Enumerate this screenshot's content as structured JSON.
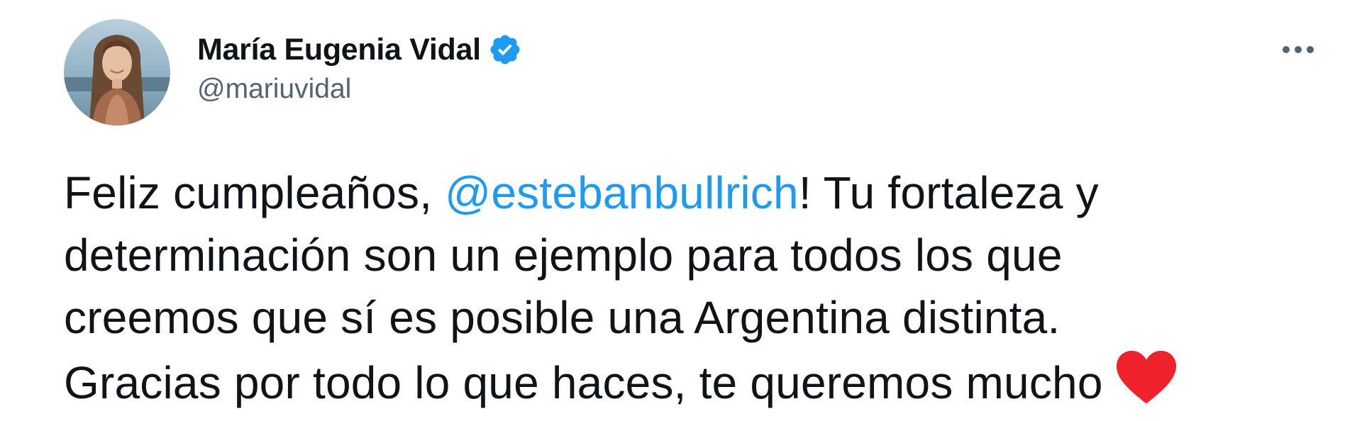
{
  "tweet": {
    "author": {
      "display_name": "María Eugenia Vidal",
      "handle": "@mariuvidal",
      "verified": true
    },
    "body": {
      "line1_before": "Feliz cumpleaños, ",
      "mention": "@estebanbullrich",
      "line1_after": "! Tu fortaleza y",
      "line2": "determinación son un ejemplo para todos los que",
      "line3": "creemos que sí es posible una Argentina distinta.",
      "line4": "Gracias por todo lo que haces, te queremos mucho"
    },
    "emoji": "red-heart-icon",
    "more_icon": "more-options-icon"
  },
  "colors": {
    "link": "#1d9bf0",
    "verified_badge": "#1d9bf0",
    "text_primary": "#0f1419",
    "text_secondary": "#536471",
    "heart": "#f91880"
  }
}
